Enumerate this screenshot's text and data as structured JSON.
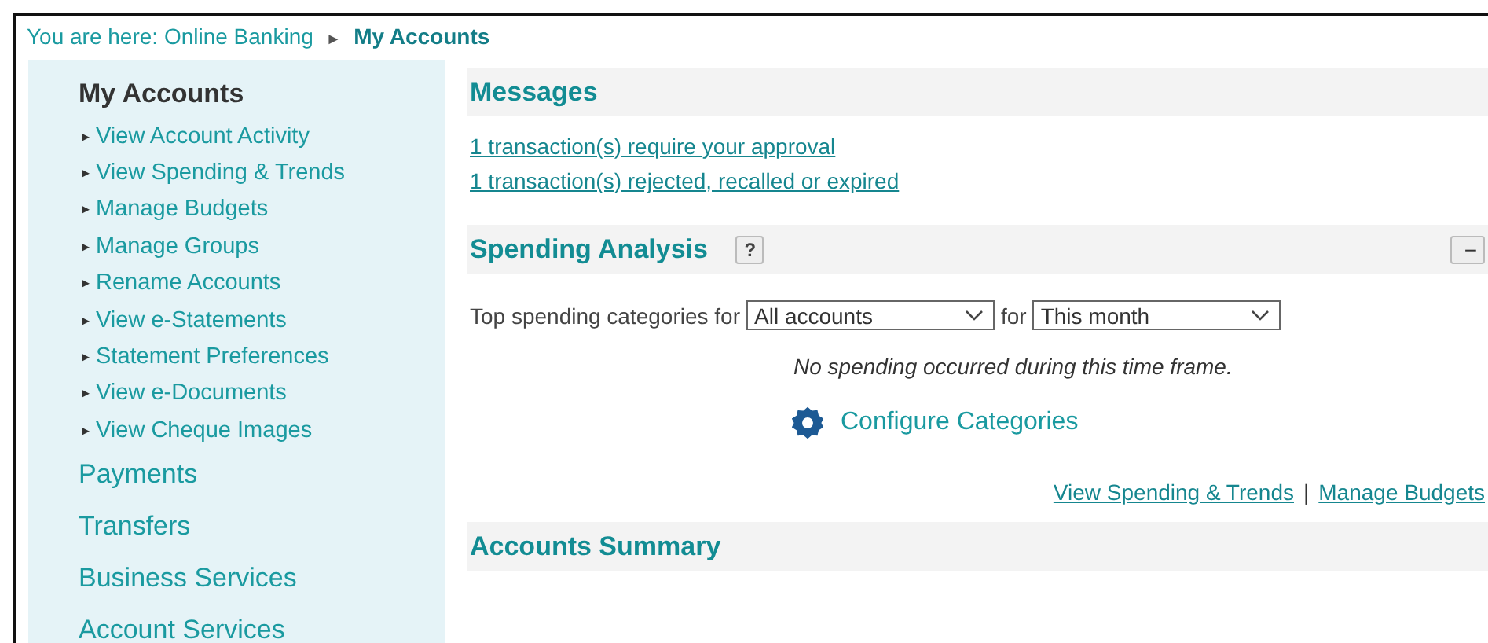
{
  "breadcrumb": {
    "prefix": "You are here: Online Banking",
    "separator": "►",
    "current": "My Accounts"
  },
  "sidebar": {
    "heading": "My Accounts",
    "items": [
      {
        "label": "View Account Activity",
        "kind": "sub"
      },
      {
        "label": "View Spending & Trends",
        "kind": "sub"
      },
      {
        "label": "Manage Budgets",
        "kind": "sub"
      },
      {
        "label": "Manage Groups",
        "kind": "sub"
      },
      {
        "label": "Rename Accounts",
        "kind": "sub"
      },
      {
        "label": "View e-Statements",
        "kind": "sub"
      },
      {
        "label": "Statement Preferences",
        "kind": "sub"
      },
      {
        "label": "View e-Documents",
        "kind": "sub"
      },
      {
        "label": "View Cheque Images",
        "kind": "sub"
      },
      {
        "label": "Payments",
        "kind": "top"
      },
      {
        "label": "Transfers",
        "kind": "top"
      },
      {
        "label": "Business Services",
        "kind": "top"
      },
      {
        "label": "Account Services",
        "kind": "top"
      }
    ],
    "bullet": "▸"
  },
  "messages": {
    "title": "Messages",
    "links": [
      "1 transaction(s) require your approval",
      "1 transaction(s) rejected, recalled or expired"
    ]
  },
  "spending": {
    "title": "Spending Analysis",
    "help": "?",
    "collapse": "−",
    "filter_label": "Top spending categories for",
    "account_select": "All accounts",
    "for_label": "for",
    "period_select": "This month",
    "empty_message": "No spending occurred during this time frame.",
    "configure": "Configure Categories",
    "links": [
      "View Spending & Trends",
      "Manage Budgets"
    ],
    "link_separator": "|"
  },
  "summary": {
    "title": "Accounts Summary"
  }
}
